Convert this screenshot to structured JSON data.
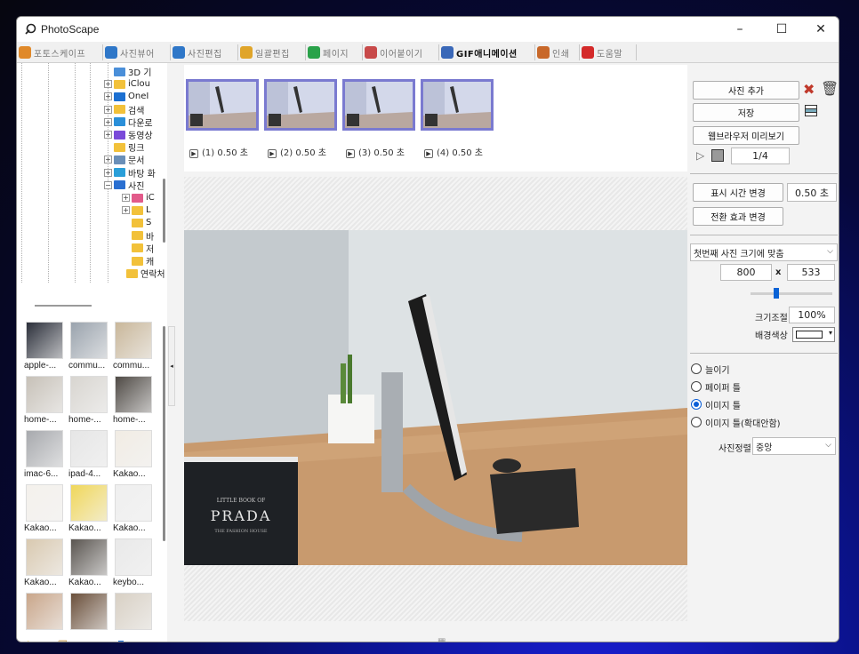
{
  "window": {
    "title": "PhotoScape"
  },
  "window_controls": {
    "minimize": "–",
    "maximize": "☐",
    "close": "✕"
  },
  "tabs": [
    {
      "label": "포토스케이프",
      "color": "#e0892a"
    },
    {
      "label": "사진뷰어",
      "color": "#2f77c8"
    },
    {
      "label": "사진편집",
      "color": "#2f77c8"
    },
    {
      "label": "일괄편집",
      "color": "#e0a52a"
    },
    {
      "label": "페이지",
      "color": "#2aa24a"
    },
    {
      "label": "이어붙이기",
      "color": "#c84a4a"
    },
    {
      "label": "GIF애니메이션",
      "color": "#3a68b8"
    },
    {
      "label": "인쇄",
      "color": "#c8682a"
    },
    {
      "label": "도움말",
      "color": "#d42a2a"
    }
  ],
  "tree": {
    "items": [
      {
        "label": "3D 기",
        "icon": "3d-folder-icon",
        "color": "#4a8fd9",
        "expand": ""
      },
      {
        "label": "iClou",
        "icon": "folder-icon",
        "color": "#f2c13a",
        "expand": "+"
      },
      {
        "label": "OneI",
        "icon": "cloud-icon",
        "color": "#1b6fd1",
        "expand": "+"
      },
      {
        "label": "검색",
        "icon": "folder-icon",
        "color": "#f2c13a",
        "expand": "+"
      },
      {
        "label": "다운로",
        "icon": "download-icon",
        "color": "#2a8fd9",
        "expand": "+"
      },
      {
        "label": "동영상",
        "icon": "video-folder-icon",
        "color": "#7a4ad9",
        "expand": "+"
      },
      {
        "label": "링크",
        "icon": "folder-icon",
        "color": "#f2c13a",
        "expand": ""
      },
      {
        "label": "문서",
        "icon": "document-folder-icon",
        "color": "#6a8fb8",
        "expand": "+"
      },
      {
        "label": "바탕 화",
        "icon": "desktop-folder-icon",
        "color": "#2a9fd9",
        "expand": "+"
      },
      {
        "label": "사진",
        "icon": "picture-folder-icon",
        "color": "#2a6fd1",
        "expand": "−"
      },
      {
        "label": "iC",
        "icon": "icloud-photos-icon",
        "color": "#e25a8a",
        "expand": "+"
      },
      {
        "label": "L",
        "icon": "folder-icon",
        "color": "#f2c13a",
        "expand": "+"
      },
      {
        "label": "S",
        "icon": "folder-icon",
        "color": "#f2c13a",
        "expand": ""
      },
      {
        "label": "바",
        "icon": "folder-icon",
        "color": "#f2c13a",
        "expand": ""
      },
      {
        "label": "저",
        "icon": "folder-icon",
        "color": "#f2c13a",
        "expand": ""
      },
      {
        "label": "캐",
        "icon": "folder-icon",
        "color": "#f2c13a",
        "expand": ""
      },
      {
        "label": "연락처",
        "icon": "folder-icon",
        "color": "#f2c13a",
        "expand": ""
      }
    ]
  },
  "thumbnails": [
    {
      "label": "apple-...",
      "tone": "#2b2f3a"
    },
    {
      "label": "commu...",
      "tone": "#9aa3ad"
    },
    {
      "label": "commu...",
      "tone": "#c9b79a"
    },
    {
      "label": "home-...",
      "tone": "#c7c1b8"
    },
    {
      "label": "home-...",
      "tone": "#d8d5d0"
    },
    {
      "label": "home-...",
      "tone": "#4f4a45"
    },
    {
      "label": "imac-6...",
      "tone": "#a7a9ad"
    },
    {
      "label": "ipad-4...",
      "tone": "#e6e6e6"
    },
    {
      "label": "Kakao...",
      "tone": "#f1ece4"
    },
    {
      "label": "Kakao...",
      "tone": "#f4f1ec"
    },
    {
      "label": "Kakao...",
      "tone": "#f0d75a"
    },
    {
      "label": "Kakao...",
      "tone": "#efefef"
    },
    {
      "label": "Kakao...",
      "tone": "#d9c9b0"
    },
    {
      "label": "Kakao...",
      "tone": "#5a5550"
    },
    {
      "label": "keybo...",
      "tone": "#e9e9e9"
    },
    {
      "label": "",
      "tone": "#c9a68a"
    },
    {
      "label": "",
      "tone": "#6a4f3a"
    },
    {
      "label": "",
      "tone": "#d8d0c4"
    }
  ],
  "frames": [
    {
      "label": "(1) 0.50 초"
    },
    {
      "label": "(2) 0.50 초"
    },
    {
      "label": "(3) 0.50 초"
    },
    {
      "label": "(4) 0.50 초"
    }
  ],
  "photo": {
    "book_brand": "PRADA",
    "book_top": "LITTLE BOOK OF",
    "book_sub": "THE FASHION HOUSE"
  },
  "right": {
    "add_photo": "사진 추가",
    "save": "저장",
    "browser_preview": "웹브라우저 미리보기",
    "frame_counter": "1/4",
    "change_display_time": "표시 시간 변경",
    "display_time_value": "0.50 초",
    "change_transition": "전환 효과 변경",
    "size_mode": "첫번째 사진 크기에 맞춤",
    "width": "800",
    "times": "x",
    "height": "533",
    "resize_label": "크기조절",
    "resize_value": "100%",
    "bg_color_label": "배경색상",
    "radios": [
      {
        "label": "늘이기",
        "checked": false
      },
      {
        "label": "페이퍼 틀",
        "checked": false
      },
      {
        "label": "이미지 틀",
        "checked": true
      },
      {
        "label": "이미지 틀(확대안함)",
        "checked": false
      }
    ],
    "align_label": "사진정렬",
    "align_value": "중앙"
  }
}
